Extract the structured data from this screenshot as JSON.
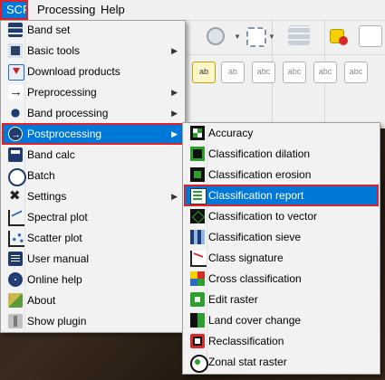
{
  "menubar": {
    "items": [
      {
        "label": "SCP",
        "active": true
      },
      {
        "label": "Processing"
      },
      {
        "label": "Help"
      }
    ]
  },
  "scp_menu": {
    "items": [
      {
        "label": "Band set",
        "icon": "band-set-icon",
        "submenu": false
      },
      {
        "label": "Basic tools",
        "icon": "basic-tools-icon",
        "submenu": true
      },
      {
        "label": "Download products",
        "icon": "download-icon",
        "submenu": false
      },
      {
        "label": "Preprocessing",
        "icon": "preprocessing-icon",
        "submenu": true
      },
      {
        "label": "Band processing",
        "icon": "band-processing-icon",
        "submenu": true
      },
      {
        "label": "Postprocessing",
        "icon": "postprocessing-icon",
        "submenu": true,
        "highlighted": true
      },
      {
        "label": "Band calc",
        "icon": "band-calc-icon",
        "submenu": false
      },
      {
        "label": "Batch",
        "icon": "batch-icon",
        "submenu": false
      },
      {
        "label": "Settings",
        "icon": "settings-icon",
        "submenu": true
      },
      {
        "label": "Spectral plot",
        "icon": "spectral-plot-icon",
        "submenu": false
      },
      {
        "label": "Scatter plot",
        "icon": "scatter-plot-icon",
        "submenu": false
      },
      {
        "label": "User manual",
        "icon": "user-manual-icon",
        "submenu": false
      },
      {
        "label": "Online help",
        "icon": "online-help-icon",
        "submenu": false
      },
      {
        "label": "About",
        "icon": "about-icon",
        "submenu": false
      },
      {
        "label": "Show plugin",
        "icon": "show-plugin-icon",
        "submenu": false
      }
    ]
  },
  "postprocessing_menu": {
    "items": [
      {
        "label": "Accuracy",
        "icon": "accuracy-icon"
      },
      {
        "label": "Classification dilation",
        "icon": "classification-dilation-icon"
      },
      {
        "label": "Classification erosion",
        "icon": "classification-erosion-icon"
      },
      {
        "label": "Classification report",
        "icon": "classification-report-icon",
        "highlighted": true
      },
      {
        "label": "Classification to vector",
        "icon": "classification-to-vector-icon"
      },
      {
        "label": "Classification sieve",
        "icon": "classification-sieve-icon"
      },
      {
        "label": "Class signature",
        "icon": "class-signature-icon"
      },
      {
        "label": "Cross classification",
        "icon": "cross-classification-icon"
      },
      {
        "label": "Edit raster",
        "icon": "edit-raster-icon"
      },
      {
        "label": "Land cover change",
        "icon": "land-cover-change-icon"
      },
      {
        "label": "Reclassification",
        "icon": "reclassification-icon"
      },
      {
        "label": "Zonal stat raster",
        "icon": "zonal-stat-raster-icon"
      }
    ]
  },
  "colors": {
    "highlight": "#0078d7",
    "annotation_border": "#e0202a"
  },
  "submenu_arrow": "▶"
}
